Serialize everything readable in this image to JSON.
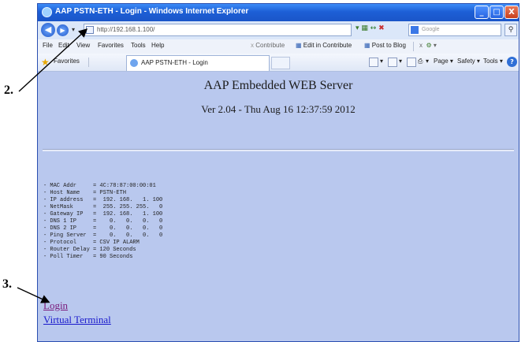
{
  "window": {
    "title": "AAP PSTN-ETH - Login - Windows Internet Explorer",
    "buttons": [
      "_",
      "□",
      "X"
    ]
  },
  "address_bar": {
    "url": "http://192.168.1.100/",
    "search_placeholder": "Google"
  },
  "menu": {
    "items": [
      "File",
      "Edit",
      "View",
      "Favorites",
      "Tools",
      "Help"
    ],
    "contribute": "Contribute",
    "edit_in_contribute": "Edit in Contribute",
    "post_to_blog": "Post to Blog"
  },
  "favorites_bar": {
    "favorites_label": "Favorites",
    "tab_title": "AAP PSTN-ETH - Login",
    "page_menu": "Page",
    "safety_menu": "Safety",
    "tools_menu": "Tools"
  },
  "page": {
    "heading": "AAP Embedded WEB Server",
    "version": "Ver 2.04 - Thu Aug 16 12:37:59 2012",
    "info_lines": [
      "- MAC Addr     = 4C:78:87:00:00:01",
      "- Host Name    = PSTN-ETH",
      "- IP address   =  192. 168.   1. 100",
      "- NetMask      =  255. 255. 255.   0",
      "- Gateway IP   =  192. 168.   1. 100",
      "- DNS 1 IP     =    0.   0.   0.   0",
      "- DNS 2 IP     =    0.   0.   0.   0",
      "- Ping Server  =    0.   0.   0.   0",
      "- Protocol     = CSV IP ALARM",
      "- Router Delay = 120 Seconds",
      "- Poll Timer   = 90 Seconds"
    ],
    "links": {
      "login": "Login",
      "virtual_terminal": "Virtual Terminal"
    }
  },
  "callouts": {
    "two": "2.",
    "three": "3."
  }
}
